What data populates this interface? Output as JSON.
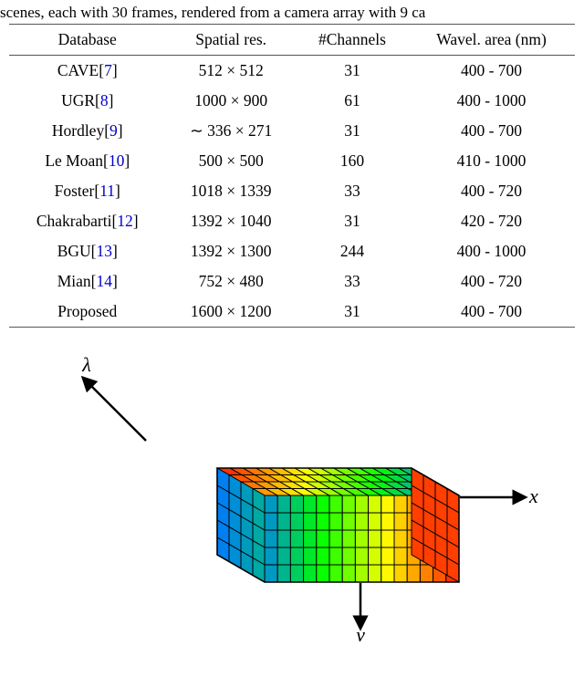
{
  "pretext": "scenes, each with 30 frames, rendered from a camera array with 9 ca",
  "table": {
    "headers": [
      "Database",
      "Spatial res.",
      "#Channels",
      "Wavel. area (nm)"
    ],
    "rows": [
      {
        "db_name": "CAVE",
        "cite": "7",
        "spatial": "512 × 512",
        "channels": "31",
        "wave": "400 - 700"
      },
      {
        "db_name": "UGR",
        "cite": "8",
        "spatial": "1000 × 900",
        "channels": "61",
        "wave": "400 - 1000"
      },
      {
        "db_name": "Hordley",
        "cite": "9",
        "spatial": "∼ 336 × 271",
        "channels": "31",
        "wave": "400 - 700"
      },
      {
        "db_name": "Le Moan",
        "cite": "10",
        "spatial": "500 × 500",
        "channels": "160",
        "wave": "410 - 1000"
      },
      {
        "db_name": "Foster",
        "cite": "11",
        "spatial": "1018 × 1339",
        "channels": "33",
        "wave": "400 - 720"
      },
      {
        "db_name": "Chakrabarti",
        "cite": "12",
        "spatial": "1392 × 1040",
        "channels": "31",
        "wave": "420 - 720"
      },
      {
        "db_name": "BGU",
        "cite": "13",
        "spatial": "1392 × 1300",
        "channels": "244",
        "wave": "400 - 1000"
      },
      {
        "db_name": "Mian",
        "cite": "14",
        "spatial": "752 × 480",
        "channels": "33",
        "wave": "400 - 720"
      },
      {
        "db_name": "Proposed",
        "cite": "",
        "spatial": "1600 × 1200",
        "channels": "31",
        "wave": "400 - 700"
      }
    ]
  },
  "figure": {
    "axis_lambda": "λ",
    "axis_x": "x",
    "axis_y": "y"
  },
  "chart_data": {
    "type": "table",
    "title": "Comparison of spectral image databases",
    "columns": [
      "Database",
      "Spatial res.",
      "#Channels",
      "Wavel. area (nm)"
    ],
    "data": [
      [
        "CAVE[7]",
        "512 × 512",
        31,
        "400 - 700"
      ],
      [
        "UGR[8]",
        "1000 × 900",
        61,
        "400 - 1000"
      ],
      [
        "Hordley[9]",
        "∼ 336 × 271",
        31,
        "400 - 700"
      ],
      [
        "Le Moan[10]",
        "500 × 500",
        160,
        "410 - 1000"
      ],
      [
        "Foster[11]",
        "1018 × 1339",
        33,
        "400 - 720"
      ],
      [
        "Chakrabarti[12]",
        "1392 × 1040",
        31,
        "420 - 720"
      ],
      [
        "BGU[13]",
        "1392 × 1300",
        244,
        "400 - 1000"
      ],
      [
        "Mian[14]",
        "752 × 480",
        33,
        "400 - 720"
      ],
      [
        "Proposed",
        "1600 × 1200",
        31,
        "400 - 700"
      ]
    ]
  }
}
